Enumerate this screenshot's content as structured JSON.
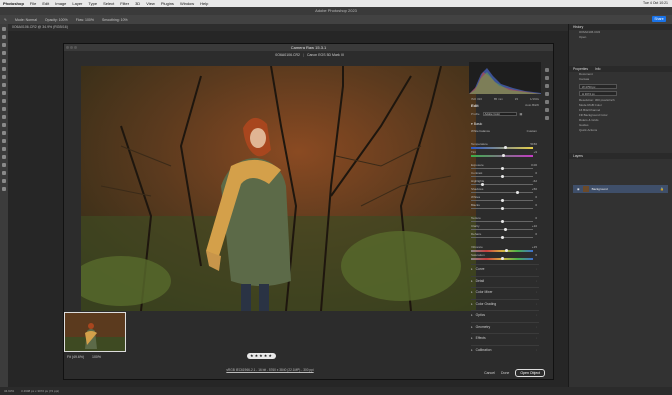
{
  "mac_menu": {
    "app": "Photoshop",
    "items": [
      "File",
      "Edit",
      "Image",
      "Layer",
      "Type",
      "Select",
      "Filter",
      "3D",
      "View",
      "Plugins",
      "Window",
      "Help"
    ],
    "clock": "Tue 4 Oct 10:21"
  },
  "ps": {
    "title": "Adobe Photoshop 2023",
    "share": "Share",
    "options": [
      "Mode: Normal",
      "Opacity: 100%",
      "Flow: 100%",
      "Smoothing: 10%"
    ],
    "doc_tab": "0O6A0106.CR2 @ 34.9% (RGB/16)",
    "zoom_status": "34.93%",
    "doc_status": "3 4608 px x 3072 px (72 ppi)"
  },
  "camera_raw": {
    "title": "Camera Raw 15.3.1",
    "filename": "0O6A0106.CR2",
    "camera": "Canon EOS 5D Mark III",
    "fit": "Fit (49.6%)",
    "zoom": "100%",
    "stars": "★★★★★",
    "footer": "sRGB IEC61966-2.1 - 16 bit - 5760 x 3840 (22.1MP) - 300 ppi",
    "meta": [
      "ISO 320",
      "85 mm",
      "f/2",
      "1/160s"
    ],
    "edit_label": "Edit",
    "edit_buttons": "Auto  B&W",
    "profile_label": "Profile",
    "profile_value": "Adobe Color",
    "basic_label": "Basic",
    "white_balance_label": "White balance",
    "white_balance_value": "Custom",
    "sliders": [
      {
        "label": "Temperature",
        "value": "5150",
        "pos": 0.55
      },
      {
        "label": "Tint",
        "value": "+9",
        "pos": 0.53
      },
      {
        "label": "Exposure",
        "value": "0.00",
        "pos": 0.5
      },
      {
        "label": "Contrast",
        "value": "0",
        "pos": 0.5
      },
      {
        "label": "Highlights",
        "value": "-62",
        "pos": 0.19
      },
      {
        "label": "Shadows",
        "value": "+50",
        "pos": 0.75
      },
      {
        "label": "Whites",
        "value": "0",
        "pos": 0.5
      },
      {
        "label": "Blacks",
        "value": "0",
        "pos": 0.5
      },
      {
        "label": "Texture",
        "value": "0",
        "pos": 0.5
      },
      {
        "label": "Clarity",
        "value": "+10",
        "pos": 0.55
      },
      {
        "label": "Dehaze",
        "value": "0",
        "pos": 0.5
      },
      {
        "label": "Vibrance",
        "value": "+15",
        "pos": 0.58
      },
      {
        "label": "Saturation",
        "value": "0",
        "pos": 0.5
      }
    ],
    "sections": [
      "Curve",
      "Detail",
      "Color Mixer",
      "Color Grading",
      "Optics",
      "Geometry",
      "Effects",
      "Calibration"
    ],
    "buttons": {
      "cancel": "Cancel",
      "done": "Done",
      "open": "Open Object"
    }
  },
  "panels": {
    "history": "History",
    "history_item": "0O6A0106.CR2",
    "history_sub": "Open",
    "properties": "Properties",
    "properties_tab": "Info",
    "doc_label": "Document",
    "canvas": "Canvas",
    "w": "W 4750 px",
    "h": "H 3072 px",
    "res": "Resolution: 300 pixels/inch",
    "mode": "Mode  RGB Color",
    "bits": "16 Bits/Channel",
    "fill": "Fill  Background Color",
    "rulers": "Rulers & Grids",
    "guides": "Guides",
    "quick": "Quick Actions",
    "layers": "Layers",
    "layer_name": "Background"
  }
}
